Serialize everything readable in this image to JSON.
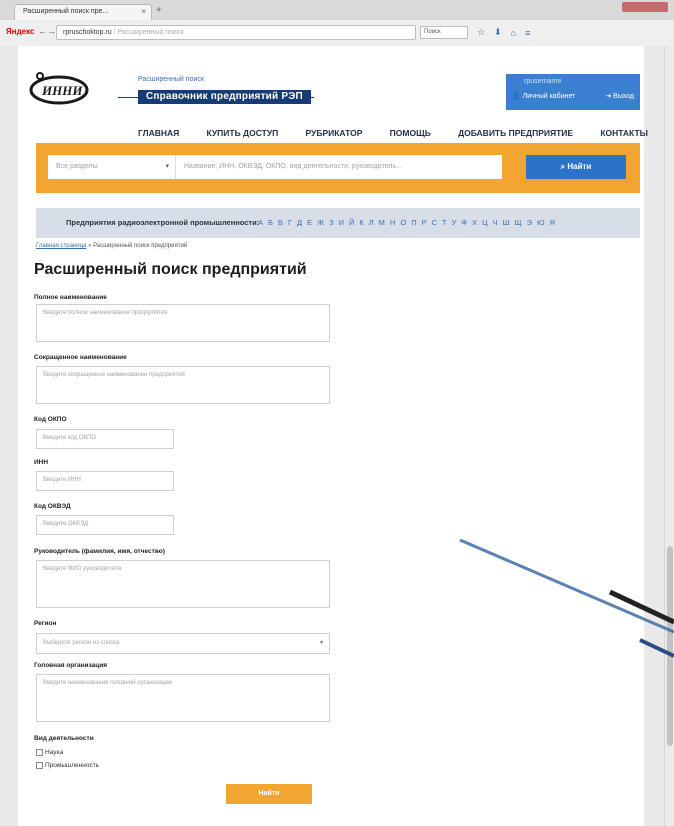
{
  "browser": {
    "tab_title": "Расширенный поиск пре...",
    "tab_close": "×",
    "new_tab": "+",
    "yandex_label": "Яндекс",
    "back": "←",
    "forward": "→",
    "url_host": "rpruschoktop.ru",
    "url_path": " / Расширенный поиск",
    "toolbar_search": "Поиск",
    "toolbar_icons": [
      "☆",
      "⬇",
      "⌂",
      "≡"
    ]
  },
  "header": {
    "logo_text": "ИННИ",
    "adv_search_link": "Расширенный поиск",
    "site_title": "Справочник предприятий РЭП",
    "user_name": "rpusername",
    "cabinet_label": "Личный кабинет",
    "logout_label": "Выход"
  },
  "menu": [
    "ГЛАВНАЯ",
    "КУПИТЬ ДОСТУП",
    "РУБРИКАТОР",
    "ПОМОЩЬ",
    "ДОБАВИТЬ ПРЕДПРИЯТИЕ",
    "КОНТАКТЫ"
  ],
  "search": {
    "dropdown_label": "Все разделы",
    "placeholder": "Название, ИНН, ОКВЭД, ОКПО, вид деятельности, руководитель...",
    "button_label": "Найти"
  },
  "alphabet": {
    "label": "Предприятия радиоэлектронной промышленности:",
    "letters": [
      "А",
      "Б",
      "В",
      "Г",
      "Д",
      "Е",
      "Ж",
      "З",
      "И",
      "Й",
      "К",
      "Л",
      "М",
      "Н",
      "О",
      "П",
      "Р",
      "С",
      "Т",
      "У",
      "Ф",
      "Х",
      "Ц",
      "Ч",
      "Ш",
      "Щ",
      "Э",
      "Ю",
      "Я"
    ]
  },
  "breadcrumb": {
    "home": "Главная страница",
    "separator": "»",
    "current": "Расширенный поиск предприятий"
  },
  "page_title": "Расширенный поиск предприятий",
  "form": {
    "full_name": {
      "label": "Полное наименование",
      "placeholder": "Введите полное наименование предприятия"
    },
    "short_name": {
      "label": "Сокращенное наименование",
      "placeholder": "Введите сокращенное наименование предприятия"
    },
    "okpo": {
      "label": "Код ОКПО",
      "placeholder": "Введите код ОКПО"
    },
    "inn": {
      "label": "ИНН",
      "placeholder": "Введите ИНН"
    },
    "okved": {
      "label": "Код ОКВЭД",
      "placeholder": "Введите ОКВЭД"
    },
    "director": {
      "label": "Руководитель (фамилия, имя, отчество)",
      "placeholder": "Введите ФИО руководителя"
    },
    "region": {
      "label": "Регион",
      "placeholder": "Выберите регион из списка"
    },
    "head_org": {
      "label": "Головная организация",
      "placeholder": "Введите наименование головной организации"
    },
    "activity": {
      "label": "Вид деятельности",
      "options": [
        "Наука",
        "Промышленность"
      ]
    },
    "submit_label": "Найти"
  }
}
